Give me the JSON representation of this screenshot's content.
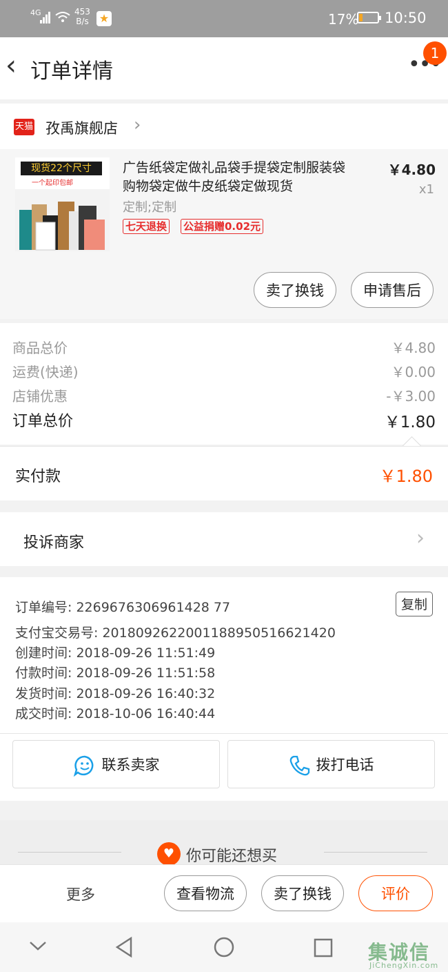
{
  "status": {
    "signal": "4G",
    "net_speed": "453",
    "net_unit": "B/s",
    "battery": "17%",
    "time": "10:50"
  },
  "nav": {
    "title": "订单详情",
    "badge": "1"
  },
  "shop": {
    "badge": "天猫",
    "name": "孜禹旗舰店"
  },
  "item": {
    "title": "广告纸袋定做礼品袋手提袋定制服装袋购物袋定做牛皮纸袋定做现货",
    "spec": "定制;定制",
    "tags": [
      "七天退换",
      "公益捐赠0.02元"
    ],
    "price": "￥4.80",
    "qty": "x1",
    "thumb_text1": "现货22个尺寸",
    "thumb_text2": "一个起印包邮",
    "actions": [
      "卖了换钱",
      "申请售后"
    ]
  },
  "summary": {
    "rows": [
      {
        "label": "商品总价",
        "value": "￥4.80"
      },
      {
        "label": "运费(快递)",
        "value": "￥0.00"
      },
      {
        "label": "店铺优惠",
        "value": "-￥3.00"
      }
    ],
    "total_label": "订单总价",
    "total_value": "￥1.80",
    "paid_label": "实付款",
    "paid_value": "￥1.80"
  },
  "complaint": {
    "label": "投诉商家"
  },
  "order": {
    "number_label": "订单编号:",
    "number": "2269676306961428 77",
    "copy_label": "复制",
    "lines": [
      "支付宝交易号: 2018092622001188950516621420",
      "创建时间: 2018-09-26 11:51:49",
      "付款时间: 2018-09-26 11:51:58",
      "发货时间: 2018-09-26 16:40:32",
      "成交时间: 2018-10-06 16:40:44"
    ]
  },
  "contact": {
    "seller": "联系卖家",
    "phone": "拨打电话"
  },
  "recommend": {
    "label": "你可能还想买"
  },
  "bottom": {
    "more": "更多",
    "logistics": "查看物流",
    "resell": "卖了换钱",
    "review": "评价"
  },
  "watermark": {
    "text": "集诚信",
    "sub": "JiChengXin.com"
  },
  "colors": {
    "accent": "#ff5000",
    "tag_red": "#e62d2d",
    "tmall_red": "#e2231a"
  }
}
